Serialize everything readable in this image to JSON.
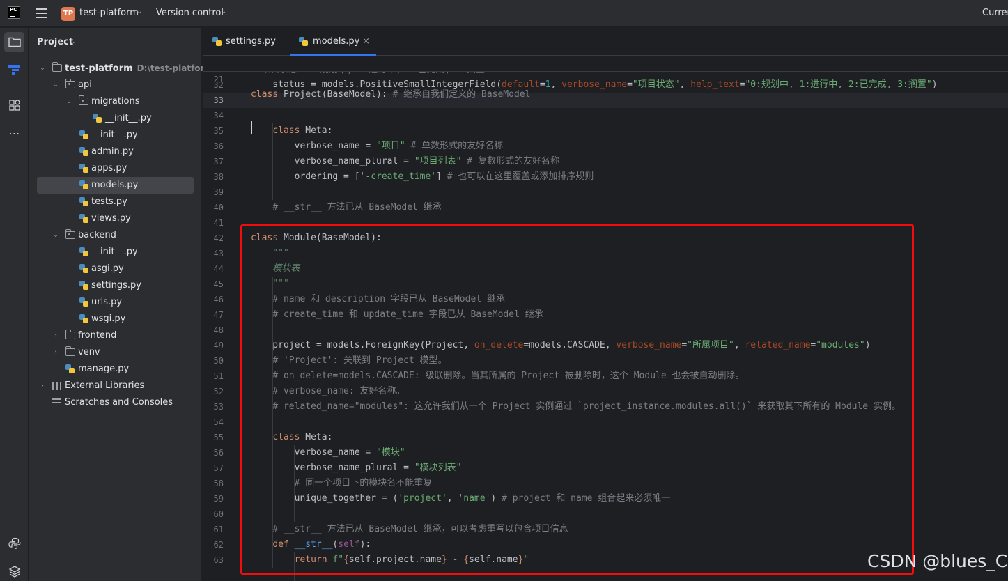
{
  "titlebar": {
    "logo_text": "PC",
    "project_badge": "TP",
    "project_name": "test-platform",
    "vcs_label": "Version control",
    "right_label": "Curren"
  },
  "project_panel": {
    "title": "Project",
    "tree": [
      {
        "label": "test-platform",
        "hint": "D:\\test-platform",
        "type": "folder"
      },
      {
        "label": "api",
        "type": "package"
      },
      {
        "label": "migrations",
        "type": "package"
      },
      {
        "label": "__init__.py",
        "type": "py"
      },
      {
        "label": "__init__.py",
        "type": "py"
      },
      {
        "label": "admin.py",
        "type": "py"
      },
      {
        "label": "apps.py",
        "type": "py"
      },
      {
        "label": "models.py",
        "type": "py"
      },
      {
        "label": "tests.py",
        "type": "py"
      },
      {
        "label": "views.py",
        "type": "py"
      },
      {
        "label": "backend",
        "type": "package"
      },
      {
        "label": "__init__.py",
        "type": "py"
      },
      {
        "label": "asgi.py",
        "type": "py"
      },
      {
        "label": "settings.py",
        "type": "py"
      },
      {
        "label": "urls.py",
        "type": "py"
      },
      {
        "label": "wsgi.py",
        "type": "py"
      },
      {
        "label": "frontend",
        "type": "folder"
      },
      {
        "label": "venv",
        "type": "folder"
      },
      {
        "label": "manage.py",
        "type": "py"
      },
      {
        "label": "External Libraries",
        "type": "library"
      },
      {
        "label": "Scratches and Consoles",
        "type": "scratches"
      }
    ]
  },
  "editor": {
    "tabs": [
      {
        "label": "settings.py",
        "active": false
      },
      {
        "label": "models.py",
        "active": true,
        "close": "×"
      }
    ],
    "sticky": {
      "num": "21",
      "text": "class Project(BaseModel): # 继承自我们定义的 BaseModel"
    },
    "lines": [
      {
        "num": "32",
        "text": "    status = models.PositiveSmallIntegerField(default=1, verbose_name=\"项目状态\", help_text=\"0:规划中, 1:进行中, 2:已完成, 3:搁置\")"
      },
      {
        "num": "33",
        "text": ""
      },
      {
        "num": "34",
        "text": ""
      },
      {
        "num": "35",
        "text": "    class Meta:"
      },
      {
        "num": "36",
        "text": "        verbose_name = \"项目\" # 单数形式的友好名称"
      },
      {
        "num": "37",
        "text": "        verbose_name_plural = \"项目列表\" # 复数形式的友好名称"
      },
      {
        "num": "38",
        "text": "        ordering = ['-create_time'] # 也可以在这里覆盖或添加排序规则"
      },
      {
        "num": "39",
        "text": ""
      },
      {
        "num": "40",
        "text": "    # __str__ 方法已从 BaseModel 继承"
      },
      {
        "num": "41",
        "text": ""
      },
      {
        "num": "42",
        "text": "class Module(BaseModel):"
      },
      {
        "num": "43",
        "text": "    \"\"\""
      },
      {
        "num": "44",
        "text": "    模块表"
      },
      {
        "num": "45",
        "text": "    \"\"\""
      },
      {
        "num": "46",
        "text": "    # name 和 description 字段已从 BaseModel 继承"
      },
      {
        "num": "47",
        "text": "    # create_time 和 update_time 字段已从 BaseModel 继承"
      },
      {
        "num": "48",
        "text": ""
      },
      {
        "num": "49",
        "text": "    project = models.ForeignKey(Project, on_delete=models.CASCADE, verbose_name=\"所属项目\", related_name=\"modules\")"
      },
      {
        "num": "50",
        "text": "    # 'Project': 关联到 Project 模型。"
      },
      {
        "num": "51",
        "text": "    # on_delete=models.CASCADE: 级联删除。当其所属的 Project 被删除时，这个 Module 也会被自动删除。"
      },
      {
        "num": "52",
        "text": "    # verbose_name: 友好名称。"
      },
      {
        "num": "53",
        "text": "    # related_name=\"modules\": 这允许我们从一个 Project 实例通过 `project_instance.modules.all()` 来获取其下所有的 Module 实例。"
      },
      {
        "num": "54",
        "text": ""
      },
      {
        "num": "55",
        "text": "    class Meta:"
      },
      {
        "num": "56",
        "text": "        verbose_name = \"模块\""
      },
      {
        "num": "57",
        "text": "        verbose_name_plural = \"模块列表\""
      },
      {
        "num": "58",
        "text": "        # 同一个项目下的模块名不能重复"
      },
      {
        "num": "59",
        "text": "        unique_together = ('project', 'name') # project 和 name 组合起来必须唯一"
      },
      {
        "num": "60",
        "text": ""
      },
      {
        "num": "61",
        "text": "    # __str__ 方法已从 BaseModel 继承，可以考虑重写以包含项目信息"
      },
      {
        "num": "62",
        "text": "    def __str__(self):"
      },
      {
        "num": "63",
        "text": "        return f\"{self.project.name} - {self.name}\""
      }
    ],
    "cursor_line": "33"
  },
  "watermark": "CSDN @blues_C",
  "colors": {
    "keyword": "#cf8e6d",
    "string": "#6aab73",
    "number": "#2aacb8",
    "comment": "#7a7e85",
    "docstring": "#5f826b",
    "highlight_box": "#f20c0c",
    "tab_underline": "#3574f0"
  },
  "icons": {
    "activity_bar": [
      "folder-icon",
      "structure-icon",
      "plugins-icon",
      "more-icon",
      "python-console-icon",
      "layers-icon"
    ]
  }
}
